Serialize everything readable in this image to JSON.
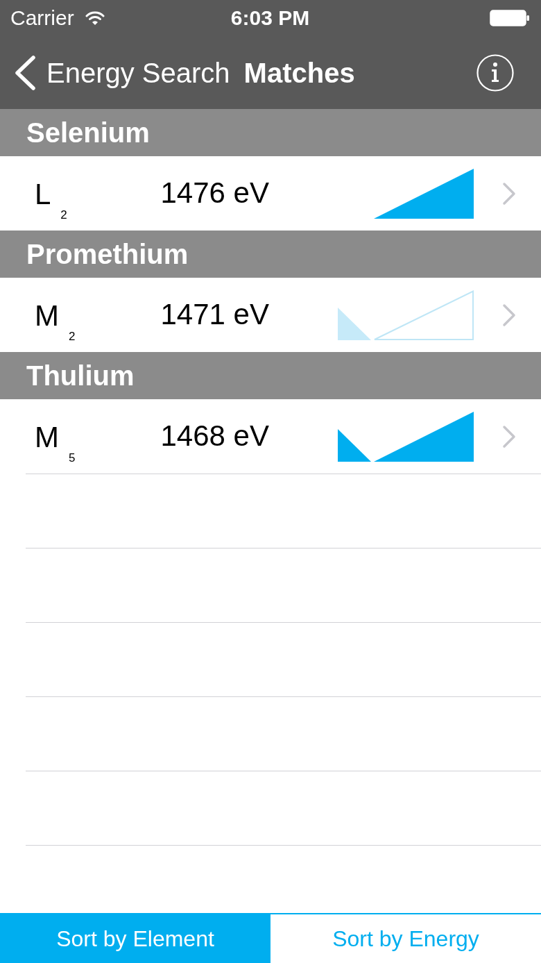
{
  "status_bar": {
    "carrier": "Carrier",
    "time": "6:03 PM"
  },
  "nav_bar": {
    "back_label": "Energy Search",
    "title": "Matches"
  },
  "sections": [
    {
      "title": "Selenium",
      "rows": [
        {
          "line": "L$_{2}$",
          "energy": "1476 eV",
          "peak": false,
          "faint": false
        }
      ]
    },
    {
      "title": "Promethium",
      "rows": [
        {
          "line": "M$_{2}$",
          "energy": "1471 eV",
          "peak": true,
          "faint": true
        }
      ]
    },
    {
      "title": "Thulium",
      "rows": [
        {
          "line": "M$_{5}$",
          "energy": "1468 eV",
          "peak": true,
          "faint": false
        }
      ]
    }
  ],
  "segmented_control": [
    {
      "label": "Sort by Element",
      "selected": true
    },
    {
      "label": "Sort by Energy",
      "selected": false
    }
  ]
}
